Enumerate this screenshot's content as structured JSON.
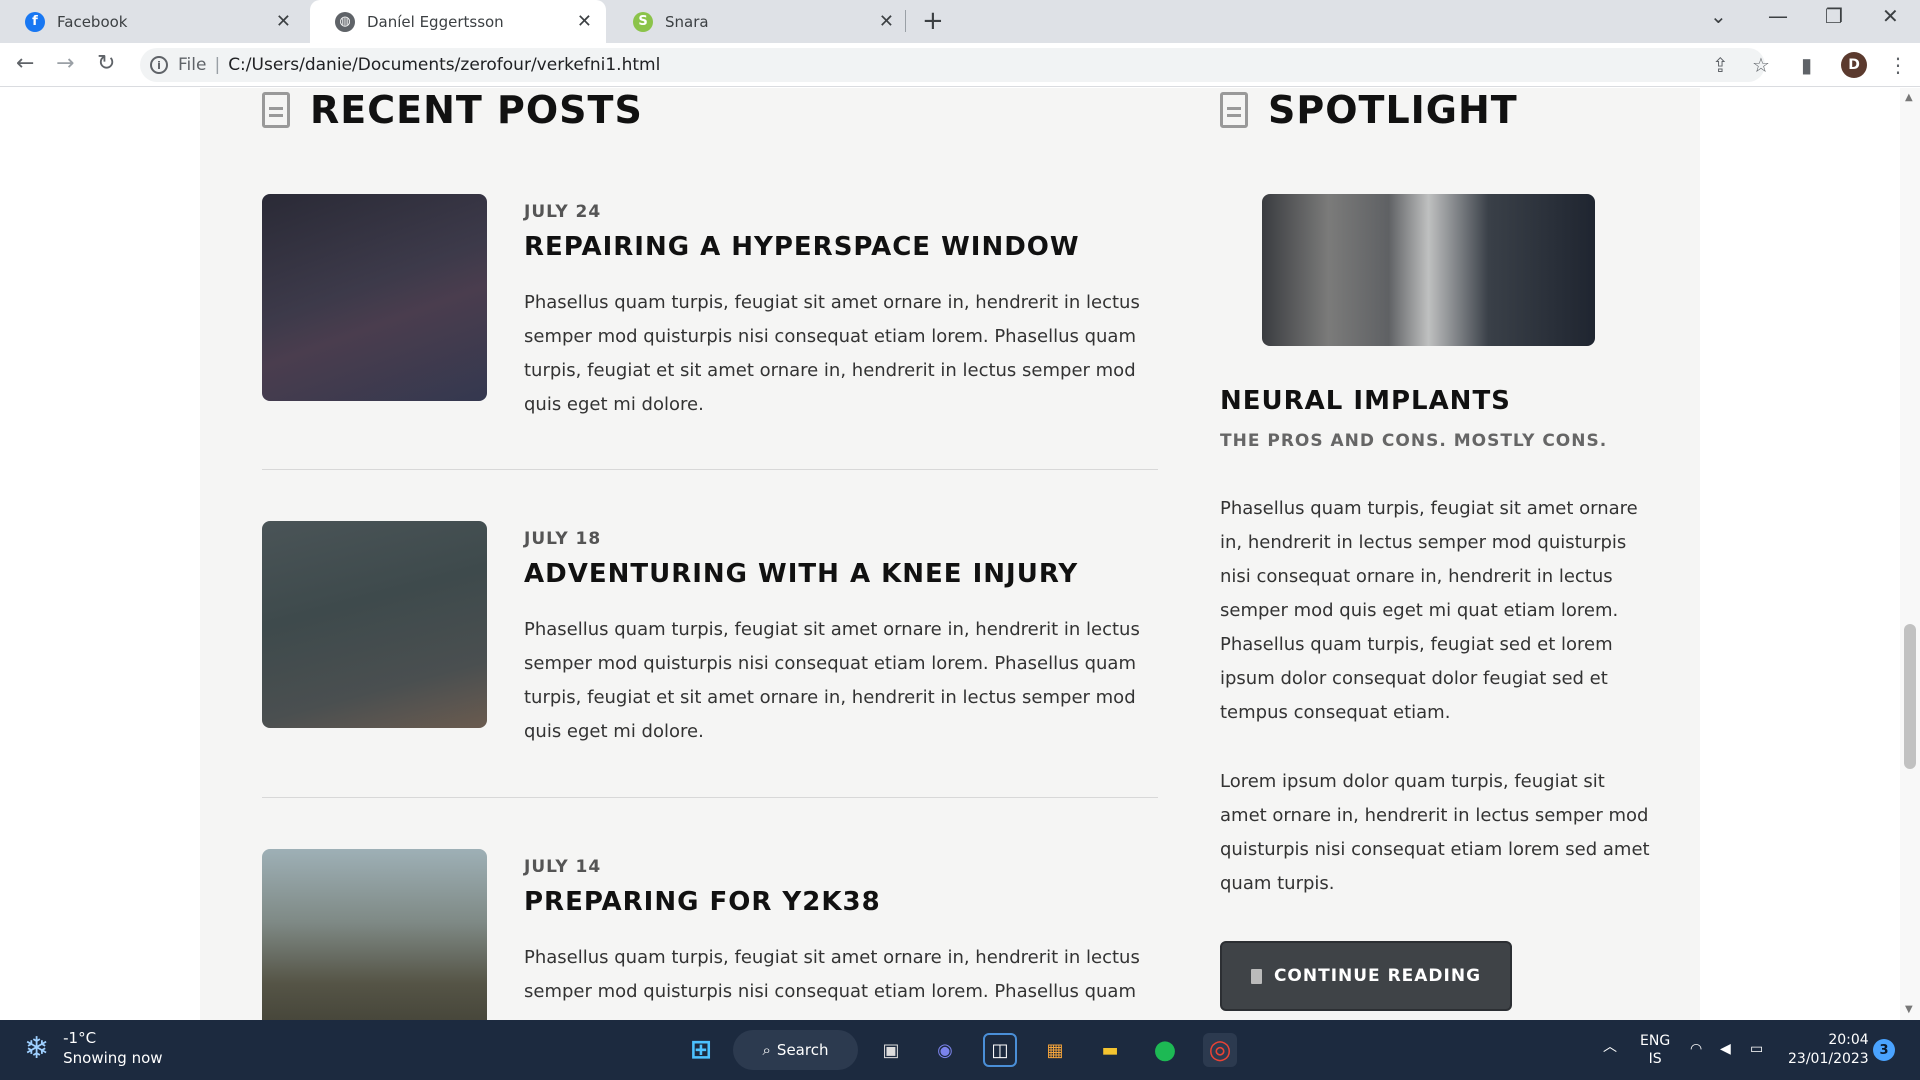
{
  "browser": {
    "tabs": [
      {
        "label": "Facebook",
        "icon": "facebook-icon",
        "active": false
      },
      {
        "label": "Daníel Eggertsson",
        "icon": "globe-icon",
        "active": true
      },
      {
        "label": "Snara",
        "icon": "snara-icon",
        "active": false
      }
    ],
    "url_scheme": "File",
    "url": "C:/Users/danie/Documents/zerofour/verkefni1.html",
    "profile_initial": "D"
  },
  "page": {
    "recent_posts_title": "RECENT POSTS",
    "posts": [
      {
        "date": "JULY 24",
        "title": "REPAIRING A HYPERSPACE WINDOW",
        "text": "Phasellus quam turpis, feugiat sit amet ornare in, hendrerit in lectus semper mod quisturpis nisi consequat etiam lorem. Phasellus quam turpis, feugiat et sit amet ornare in, hendrerit in lectus semper mod quis eget mi dolore."
      },
      {
        "date": "JULY 18",
        "title": "ADVENTURING WITH A KNEE INJURY",
        "text": "Phasellus quam turpis, feugiat sit amet ornare in, hendrerit in lectus semper mod quisturpis nisi consequat etiam lorem. Phasellus quam turpis, feugiat et sit amet ornare in, hendrerit in lectus semper mod quis eget mi dolore."
      },
      {
        "date": "JULY 14",
        "title": "PREPARING FOR Y2K38",
        "text": "Phasellus quam turpis, feugiat sit amet ornare in, hendrerit in lectus semper mod quisturpis nisi consequat etiam lorem. Phasellus quam"
      }
    ],
    "spotlight_title": "SPOTLIGHT",
    "spotlight": {
      "title": "NEURAL IMPLANTS",
      "subtitle": "THE PROS AND CONS. MOSTLY CONS.",
      "paragraph1": "Phasellus quam turpis, feugiat sit amet ornare in, hendrerit in lectus semper mod quisturpis nisi consequat ornare in, hendrerit in lectus semper mod quis eget mi quat etiam lorem. Phasellus quam turpis, feugiat sed et lorem ipsum dolor consequat dolor feugiat sed et tempus consequat etiam.",
      "paragraph2": "Lorem ipsum dolor quam turpis, feugiat sit amet ornare in, hendrerit in lectus semper mod quisturpis nisi consequat etiam lorem sed amet quam turpis.",
      "button_label": "CONTINUE READING"
    }
  },
  "taskbar": {
    "weather_temp": "-1°C",
    "weather_desc": "Snowing now",
    "search_label": "Search",
    "lang_top": "ENG",
    "lang_bottom": "IS",
    "time": "20:04",
    "date": "23/01/2023",
    "notifications": "3"
  }
}
